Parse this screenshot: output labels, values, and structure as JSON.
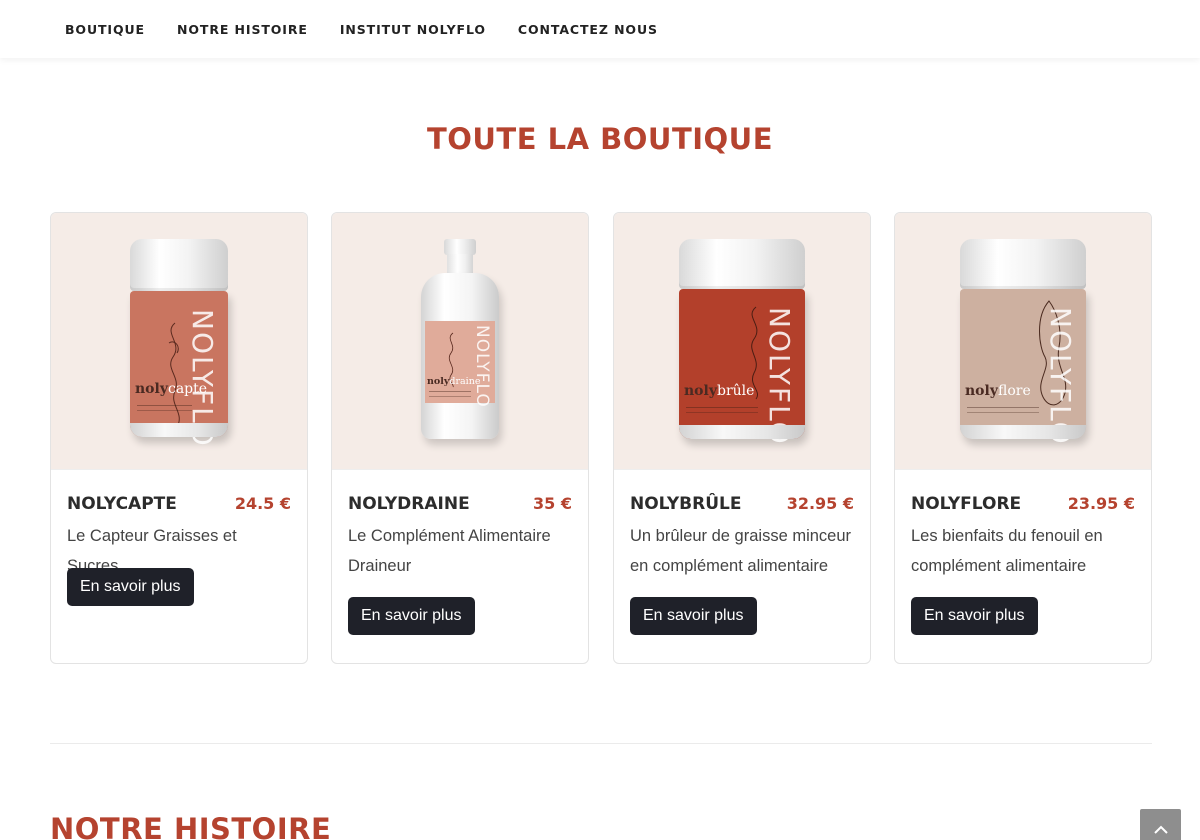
{
  "nav": {
    "items": [
      {
        "label": "BOUTIQUE"
      },
      {
        "label": "NOTRE HISTOIRE"
      },
      {
        "label": "INSTITUT NOLYFLO"
      },
      {
        "label": "CONTACTEZ NOUS"
      }
    ]
  },
  "shop": {
    "title": "TOUTE LA BOUTIQUE",
    "products": [
      {
        "name": "NOLYCAPTE",
        "price": "24.5 €",
        "description": "Le Capteur Graisses et Sucres",
        "button": "En savoir plus",
        "image": {
          "brand": "NOLYFLO",
          "prefix": "noly",
          "suffix": "capte",
          "label_color": "#c97560"
        }
      },
      {
        "name": "NOLYDRAINE",
        "price": "35 €",
        "description": "Le Complément Alimentaire Draineur",
        "button": "En savoir plus",
        "image": {
          "brand": "NOLYFLO",
          "prefix": "noly",
          "suffix": "draine",
          "label_color": "#e0ab9a"
        }
      },
      {
        "name": "NOLYBRÛLE",
        "price": "32.95 €",
        "description": "Un brûleur de graisse minceur en complément alimentaire",
        "button": "En savoir plus",
        "image": {
          "brand": "NOLYFLO",
          "prefix": "noly",
          "suffix": "brûle",
          "label_color": "#b3402b"
        }
      },
      {
        "name": "NOLYFLORE",
        "price": "23.95 €",
        "description": "Les bienfaits du fenouil en complément alimentaire",
        "button": "En savoir plus",
        "image": {
          "brand": "NOLYFLO",
          "prefix": "noly",
          "suffix": "flore",
          "label_color": "#cdb0a0"
        }
      }
    ]
  },
  "history": {
    "title": "NOTRE HISTOIRE"
  },
  "colors": {
    "accent": "#b5432f",
    "button_bg": "#1f2129",
    "card_media_bg": "#f5ece7"
  },
  "icons": {
    "scroll_top": "chevron-up-icon"
  }
}
